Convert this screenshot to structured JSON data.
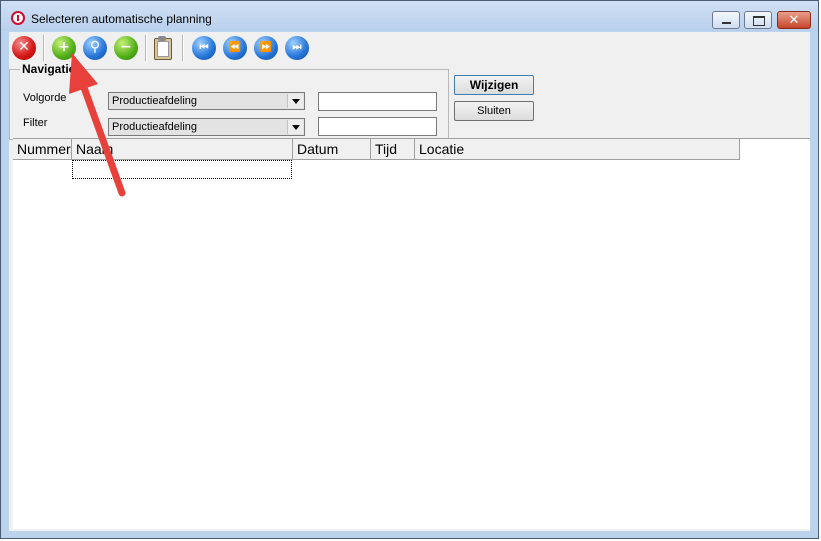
{
  "window": {
    "title": "Selecteren automatische planning",
    "controls": {
      "minimize_icon": "minimize-icon",
      "maximize_icon": "maximize-icon",
      "close_icon": "close-icon",
      "close_glyph": "✕"
    }
  },
  "toolbar": {
    "buttons": [
      {
        "name": "delete",
        "icon": "delete-icon",
        "glyph": "✕",
        "color": "#d41414"
      },
      {
        "name": "add",
        "icon": "add-icon",
        "glyph": "+",
        "color": "#4fae16"
      },
      {
        "name": "search",
        "icon": "search-icon",
        "glyph": "⚲",
        "color": "#2474d8"
      },
      {
        "name": "remove",
        "icon": "remove-icon",
        "glyph": "−",
        "color": "#4fae16"
      },
      {
        "name": "clipboard",
        "icon": "clipboard-icon"
      },
      {
        "name": "first",
        "icon": "first-record-icon",
        "glyph": "⏮",
        "color": "#2474d8"
      },
      {
        "name": "previous",
        "icon": "previous-record-icon",
        "glyph": "⏪",
        "color": "#2474d8"
      },
      {
        "name": "next",
        "icon": "next-record-icon",
        "glyph": "⏩",
        "color": "#2474d8"
      },
      {
        "name": "last",
        "icon": "last-record-icon",
        "glyph": "⏭",
        "color": "#2474d8"
      }
    ]
  },
  "navigation": {
    "title": "Navigatie",
    "sort_label": "Volgorde",
    "sort_value": "Productieafdeling",
    "sort_text": "",
    "filter_label": "Filter",
    "filter_value": "Productieafdeling",
    "filter_text": ""
  },
  "actions": {
    "edit_label": "Wijzigen",
    "close_label": "Sluiten"
  },
  "grid": {
    "columns": [
      "Nummer",
      "Naam",
      "Datum",
      "Tijd",
      "Locatie"
    ],
    "rows": []
  },
  "annotation": {
    "arrow_color": "#e8403a"
  }
}
